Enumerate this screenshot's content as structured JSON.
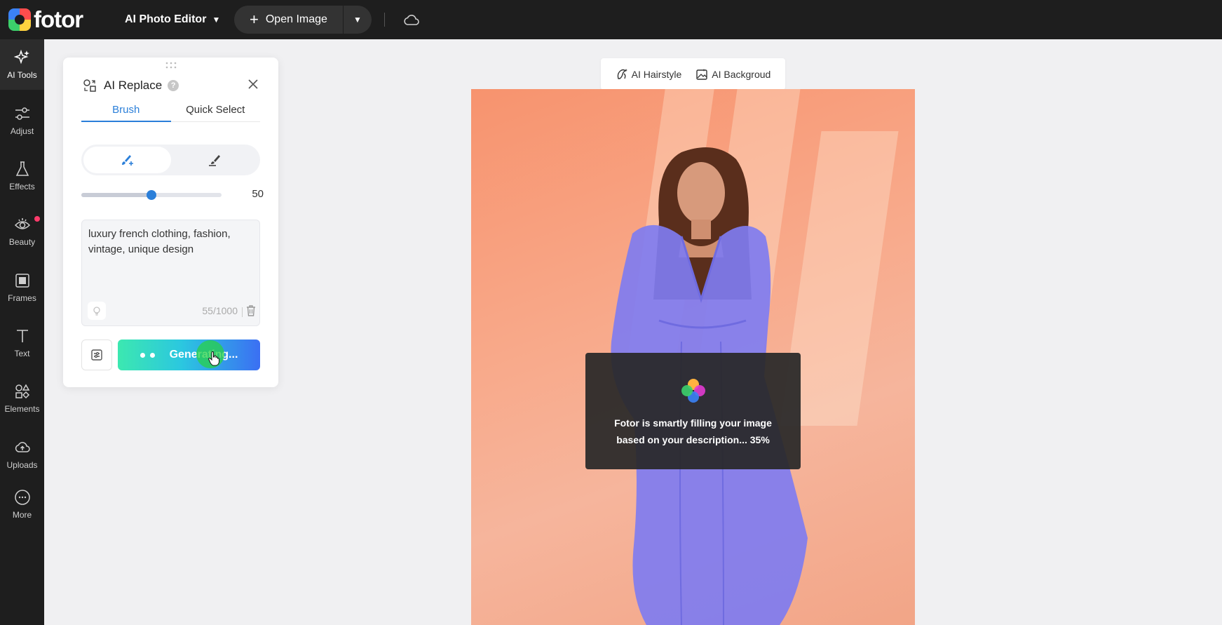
{
  "app": {
    "logo_text": "fotor",
    "editor_mode": "AI Photo Editor",
    "open_image_label": "Open Image"
  },
  "nav": {
    "items": [
      {
        "label": "AI Tools",
        "icon": "sparkle-icon",
        "active": true
      },
      {
        "label": "Adjust",
        "icon": "sliders-icon"
      },
      {
        "label": "Effects",
        "icon": "flask-icon"
      },
      {
        "label": "Beauty",
        "icon": "eye-icon",
        "badge": true
      },
      {
        "label": "Frames",
        "icon": "frame-icon"
      },
      {
        "label": "Text",
        "icon": "text-icon"
      },
      {
        "label": "Elements",
        "icon": "shapes-icon"
      },
      {
        "label": "Uploads",
        "icon": "cloud-upload-icon"
      },
      {
        "label": "More",
        "icon": "more-icon"
      }
    ]
  },
  "panel": {
    "title": "AI Replace",
    "help_glyph": "?",
    "tabs": [
      {
        "label": "Brush",
        "active": true
      },
      {
        "label": "Quick Select",
        "active": false
      }
    ],
    "brush_size": 50,
    "brush_size_label": "50",
    "prompt_text": "luxury french clothing, fashion, vintage, unique design",
    "prompt_count": "55/1000",
    "generate_label": "Generating..."
  },
  "quick_tools": {
    "hairstyle_label": "AI Hairstyle",
    "background_label": "AI Backgroud"
  },
  "toast": {
    "message": "Fotor is smartly filling your image based on your description... 35%",
    "progress": 35
  },
  "colors": {
    "accent": "#2b7fd9",
    "topbar": "#1e1e1e",
    "mask": "#7f7cf0",
    "badge": "#ff3b6b"
  }
}
